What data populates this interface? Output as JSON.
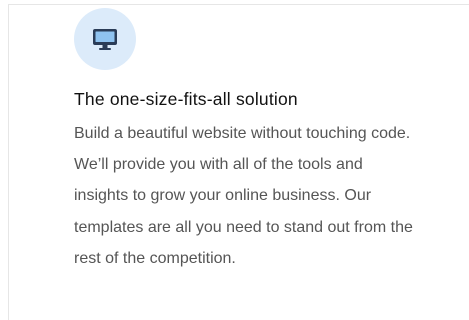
{
  "feature": {
    "icon": "desktop-monitor-icon",
    "icon_color": "#2a3c57",
    "icon_bg_color": "#dcebfa",
    "title": "The one-size-fits-all solution",
    "description": "Build a beautiful website without touching code. We’ll provide you with all of the tools and insights to grow your online business. Our templates are all you need to stand out from the rest of the competition."
  }
}
